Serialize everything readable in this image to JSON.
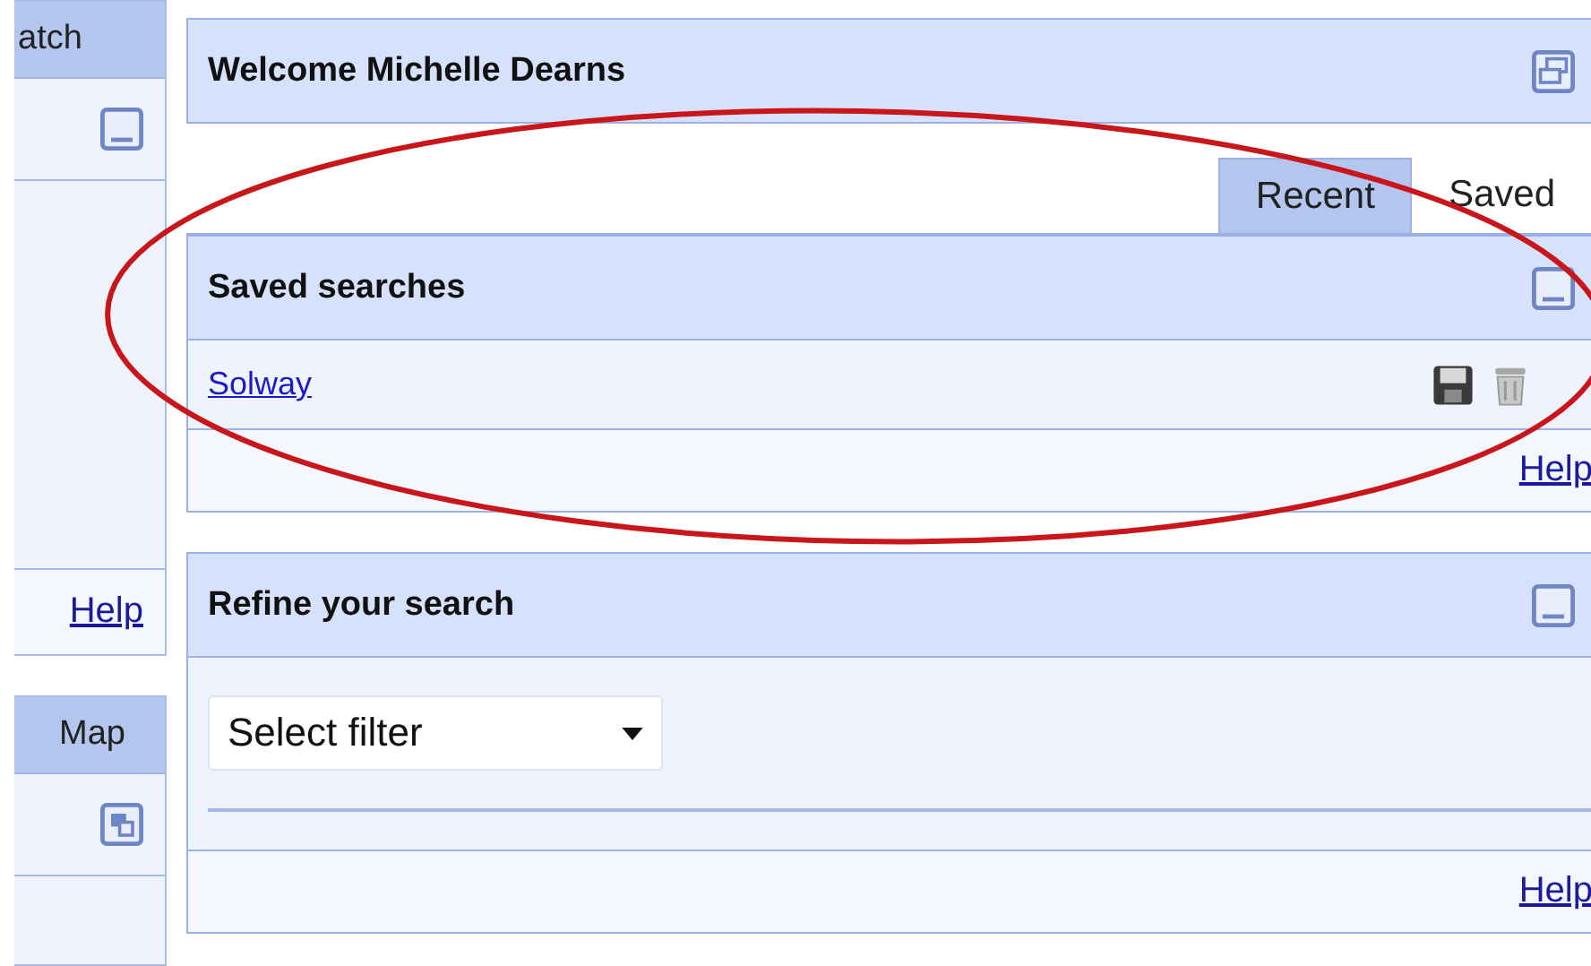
{
  "sidebar": [
    {
      "title": "atch",
      "help": "Help"
    },
    {
      "title": "Map"
    }
  ],
  "welcome": {
    "title": "Welcome Michelle Dearns"
  },
  "tabs": [
    {
      "label": "Recent",
      "selected": true
    },
    {
      "label": "Saved",
      "selected": false
    }
  ],
  "saved_searches": {
    "title": "Saved searches",
    "items": [
      {
        "name": "Solway"
      }
    ],
    "help": "Help"
  },
  "refine": {
    "title": "Refine your search",
    "filter": {
      "value": "Select filter"
    },
    "help": "Help"
  }
}
